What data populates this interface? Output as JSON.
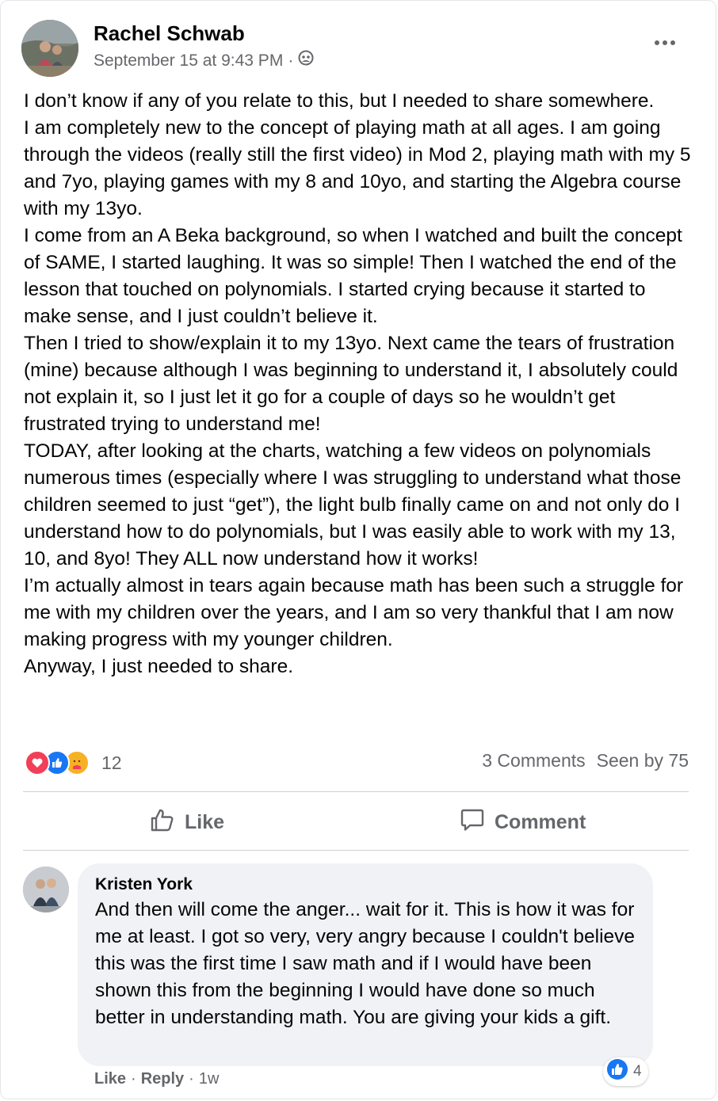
{
  "post": {
    "author": "Rachel Schwab",
    "timestamp": "September 15 at 9:43 PM",
    "separator": "·",
    "privacy_icon": "group-audience-icon",
    "more_icon": "more-options-icon",
    "paragraphs": [
      "I don’t know if any of you relate to this, but I needed to share somewhere.",
      "I am completely new to the concept of playing math at all ages. I am going through the videos (really still the first video) in Mod 2, playing math with my 5 and 7yo, playing games with my 8 and 10yo, and starting the Algebra course with my 13yo.",
      "I come from an A Beka background, so when I watched and built the concept of SAME, I started laughing. It was so simple! Then I watched the end of the lesson that touched on polynomials. I started crying because it started to make sense, and I just couldn’t believe it.",
      "Then I tried to show/explain it to my 13yo. Next came the tears of frustration (mine) because although I was beginning to understand it, I absolutely could not explain it, so I just let it go for a couple of days so he wouldn’t get frustrated trying to understand me!",
      "TODAY, after looking at the charts, watching a few videos on polynomials numerous times (especially where I was struggling to understand what those children seemed to just “get”), the light bulb finally came on and not only do I understand how to do polynomials, but I was easily able to work with my 13, 10, and 8yo! They ALL now understand how it works!",
      "I’m actually almost in tears again because math has been such a struggle for me with my children over the years, and I am so very thankful that I am now making progress with my younger children.",
      "Anyway, I just needed to share."
    ],
    "reactions": {
      "icons": [
        "love-reaction-icon",
        "like-reaction-icon",
        "care-reaction-icon"
      ],
      "count": "12",
      "colors": {
        "love": "#f33e58",
        "like": "#1877f2",
        "care": "#f7b125"
      }
    },
    "stats": {
      "comments": "3 Comments",
      "seen": "Seen by 75"
    },
    "actions": {
      "like": "Like",
      "comment": "Comment"
    }
  },
  "comment": {
    "author": "Kristen York",
    "text": "And then will come the anger... wait for it. This is how it was for me at least. I got so very, very angry because I couldn't believe this was the first time I saw math and if I would have been shown this from the beginning I would have done so much better in understanding math. You are giving your kids a gift.",
    "reaction_count": "4",
    "like_label": "Like",
    "reply_label": "Reply",
    "separator": "·",
    "age": "1w"
  },
  "colors": {
    "text_primary": "#050505",
    "text_secondary": "#65676b",
    "bubble_bg": "#f0f2f5",
    "divider": "#ced0d4",
    "brand_blue": "#1877f2"
  }
}
